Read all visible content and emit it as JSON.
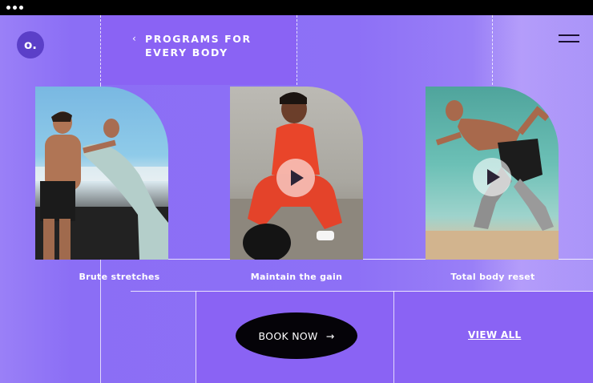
{
  "window": {
    "controls": [
      "dot",
      "dot",
      "dot"
    ]
  },
  "header": {
    "logo_text": "o.",
    "title_line1": "PROGRAMS FOR",
    "title_line2": "EVERY BODY",
    "back_glyph": "‹",
    "menu_icon": "hamburger-icon"
  },
  "programs": [
    {
      "caption": "Brute stretches",
      "has_play": false
    },
    {
      "caption": "Maintain the gain",
      "has_play": true
    },
    {
      "caption": "Total body reset",
      "has_play": true
    }
  ],
  "actions": {
    "book_label": "BOOK NOW",
    "book_arrow": "→",
    "view_all_label": "VIEW ALL"
  },
  "colors": {
    "background": "#8a6cf3",
    "panel": "#8a63f4",
    "button": "#050308",
    "text": "#ffffff"
  }
}
